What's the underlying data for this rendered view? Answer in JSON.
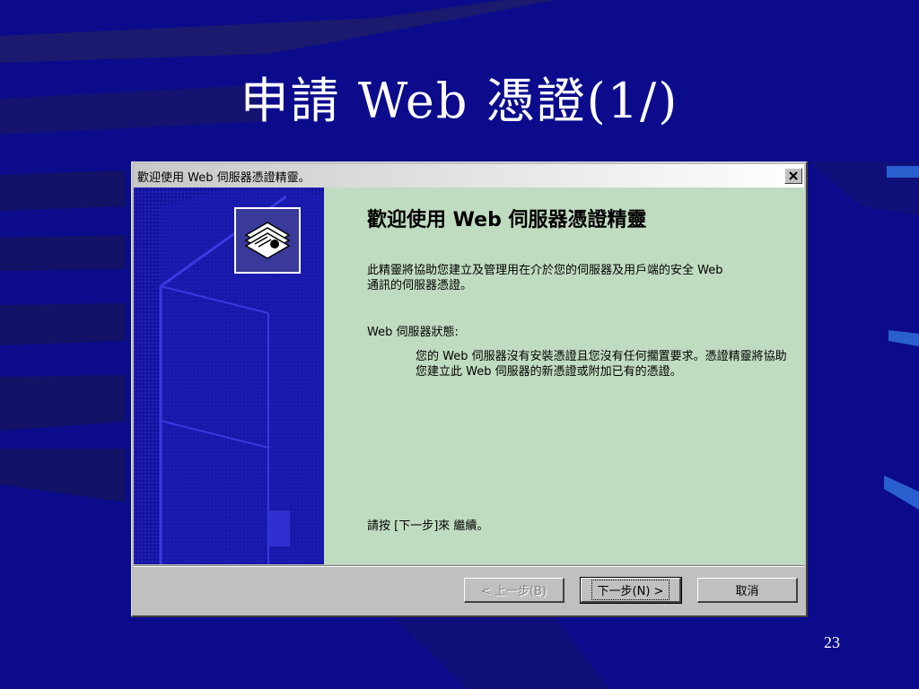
{
  "slide": {
    "title": "申請 Web 憑證(1/)",
    "page_number": "23"
  },
  "dialog": {
    "window_title": "歡迎使用 Web 伺服器憑證精靈。",
    "close_label": "x",
    "side_icon": "certificate-icon",
    "heading": "歡迎使用 Web 伺服器憑證精靈",
    "intro": "此精靈將協助您建立及管理用在介於您的伺服器及用戶端的安全 Web 通訊的伺服器憑證。",
    "status_label": "Web 伺服器狀態:",
    "status_text": "您的 Web 伺服器沒有安裝憑證且您沒有任何擱置要求。憑證精靈將協助您建立此 Web 伺服器的新憑證或附加已有的憑證。",
    "next_hint": "請按 [下一步]來 繼續。",
    "buttons": {
      "back": "< 上一步(B)",
      "next": "下一步(N) >",
      "cancel": "取消"
    }
  }
}
